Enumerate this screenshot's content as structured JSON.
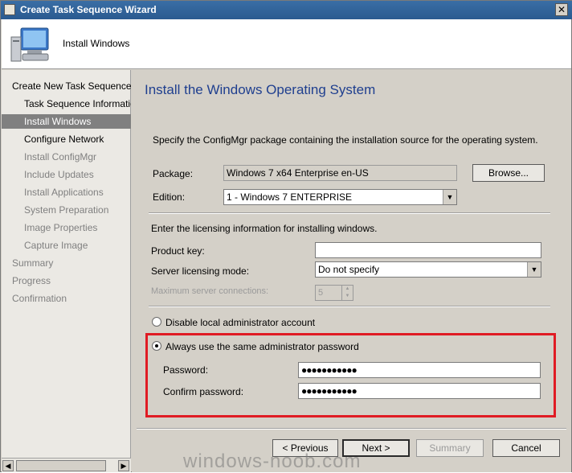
{
  "window": {
    "title": "Create Task Sequence Wizard",
    "close_glyph": "✕"
  },
  "header": {
    "title": "Install Windows",
    "icon": "computer-icon"
  },
  "nav": {
    "items": [
      {
        "label": "Create New Task Sequence",
        "level": "top",
        "state": "dark"
      },
      {
        "label": "Task Sequence Information",
        "level": "sub",
        "state": "dark"
      },
      {
        "label": "Install Windows",
        "level": "sub",
        "state": "selected"
      },
      {
        "label": "Configure Network",
        "level": "sub",
        "state": "dark"
      },
      {
        "label": "Install ConfigMgr",
        "level": "sub",
        "state": "gray"
      },
      {
        "label": "Include Updates",
        "level": "sub",
        "state": "gray"
      },
      {
        "label": "Install Applications",
        "level": "sub",
        "state": "gray"
      },
      {
        "label": "System Preparation",
        "level": "sub",
        "state": "gray"
      },
      {
        "label": "Image Properties",
        "level": "sub",
        "state": "gray"
      },
      {
        "label": "Capture Image",
        "level": "sub",
        "state": "gray"
      },
      {
        "label": "Summary",
        "level": "top",
        "state": "gray"
      },
      {
        "label": "Progress",
        "level": "top",
        "state": "gray"
      },
      {
        "label": "Confirmation",
        "level": "top",
        "state": "gray"
      }
    ]
  },
  "page": {
    "heading": "Install the Windows Operating System",
    "intro": "Specify the ConfigMgr package containing the installation source for the operating system.",
    "package_label": "Package:",
    "package_value": "Windows 7 x64 Enterprise en-US",
    "browse_label": "Browse...",
    "edition_label": "Edition:",
    "edition_value": "1 - Windows 7 ENTERPRISE",
    "licensing_intro": "Enter the licensing information for installing windows.",
    "product_key_label": "Product key:",
    "product_key_value": "",
    "server_mode_label": "Server licensing mode:",
    "server_mode_value": "Do not specify",
    "max_conn_label": "Maximum server connections:",
    "max_conn_value": "5",
    "disable_admin_label": "Disable local administrator account",
    "same_pw_label": "Always use the same administrator password",
    "password_label": "Password:",
    "password_value": "●●●●●●●●●●●",
    "confirm_label": "Confirm password:",
    "confirm_value": "●●●●●●●●●●●"
  },
  "buttons": {
    "previous": "< Previous",
    "next": "Next >",
    "summary": "Summary",
    "cancel": "Cancel"
  },
  "watermark": "windows-noob.com"
}
